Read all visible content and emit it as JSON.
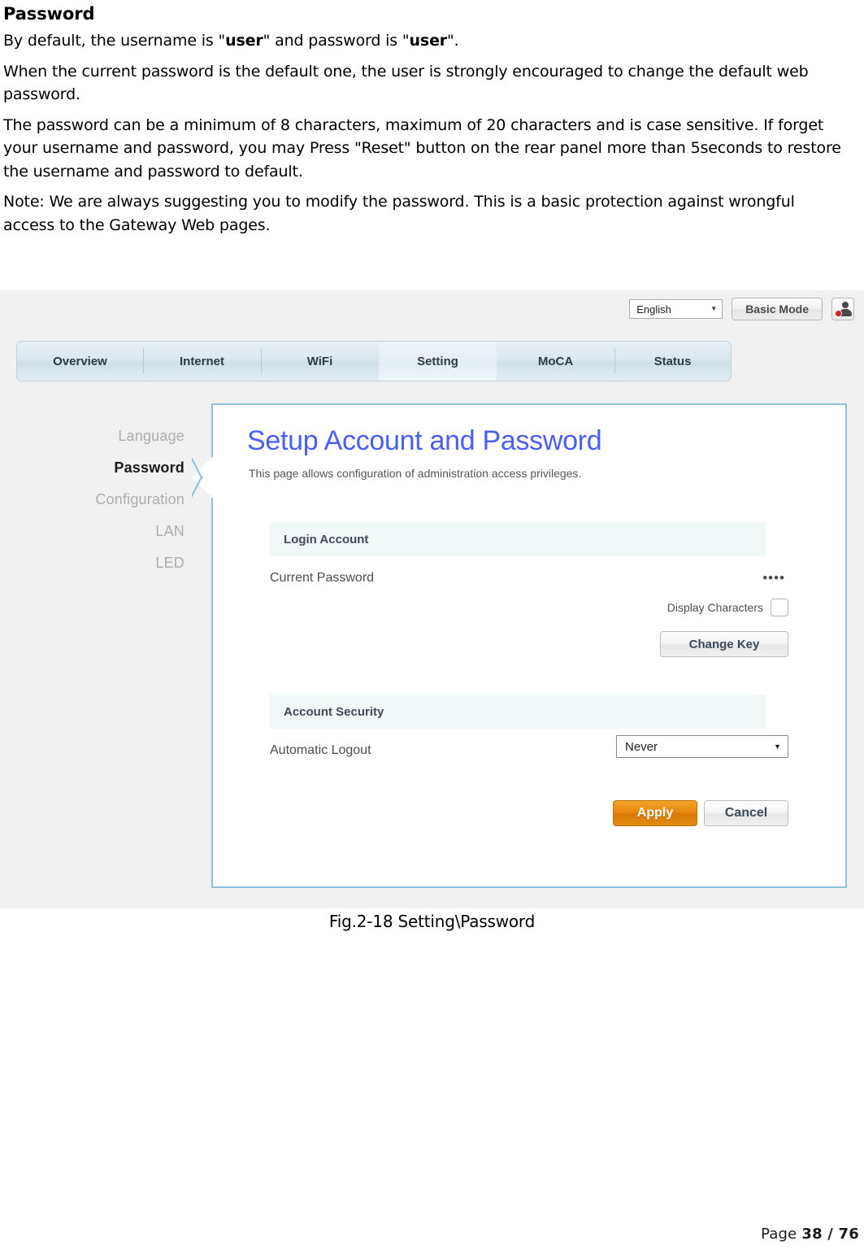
{
  "document": {
    "heading": "Password",
    "paragraphs": [
      {
        "parts": [
          {
            "text": "By default, the username is \"",
            "bold": false
          },
          {
            "text": "user",
            "bold": true
          },
          {
            "text": "\" and password is \"",
            "bold": false
          },
          {
            "text": "user",
            "bold": true
          },
          {
            "text": "\".",
            "bold": false
          }
        ]
      },
      {
        "parts": [
          {
            "text": "When the current password is the default one, the user is strongly encouraged to change the default web password.",
            "bold": false
          }
        ]
      },
      {
        "parts": [
          {
            "text": "The password can be a minimum of 8 characters, maximum of 20 characters and is case sensitive. If forget your username and password, you may Press \"Reset\" button on the rear panel more than 5seconds to restore the username and password to default.",
            "bold": false
          }
        ]
      },
      {
        "parts": [
          {
            "text": "Note: We are always suggesting you to modify the password. This is a basic protection against wrongful access to the Gateway Web pages.",
            "bold": false
          }
        ]
      }
    ],
    "caption": "Fig.2-18 Setting\\Password",
    "footer": {
      "prefix": "Page ",
      "page_numbers": "38 / 76"
    }
  },
  "screenshot": {
    "utility_bar": {
      "language_value": "English",
      "language_caret": "▼",
      "mode_button": "Basic Mode",
      "user_icon_name": "user-account-icon"
    },
    "nav_tabs": [
      {
        "label": "Overview",
        "active": false
      },
      {
        "label": "Internet",
        "active": false
      },
      {
        "label": "WiFi",
        "active": false
      },
      {
        "label": "Setting",
        "active": true
      },
      {
        "label": "MoCA",
        "active": false
      },
      {
        "label": "Status",
        "active": false
      }
    ],
    "sidebar": {
      "items": [
        {
          "label": "Language",
          "active": false
        },
        {
          "label": "Password",
          "active": true
        },
        {
          "label": "Configuration",
          "active": false
        },
        {
          "label": "LAN",
          "active": false
        },
        {
          "label": "LED",
          "active": false
        }
      ]
    },
    "panel": {
      "title": "Setup Account and Password",
      "subtitle": "This page allows configuration of administration access privileges.",
      "title_color": "#4a5ef5",
      "border_color": "#8ec0da",
      "sections": {
        "login_account": {
          "header": "Login Account",
          "current_password_label": "Current Password",
          "current_password_value": "••••",
          "display_characters_label": "Display Characters",
          "display_characters_checked": false,
          "change_key_button": "Change Key"
        },
        "account_security": {
          "header": "Account Security",
          "automatic_logout_label": "Automatic Logout",
          "automatic_logout_value": "Never",
          "select_caret": "▼"
        }
      },
      "buttons": {
        "apply": "Apply",
        "cancel": "Cancel",
        "apply_color": "#e8860c"
      }
    }
  }
}
